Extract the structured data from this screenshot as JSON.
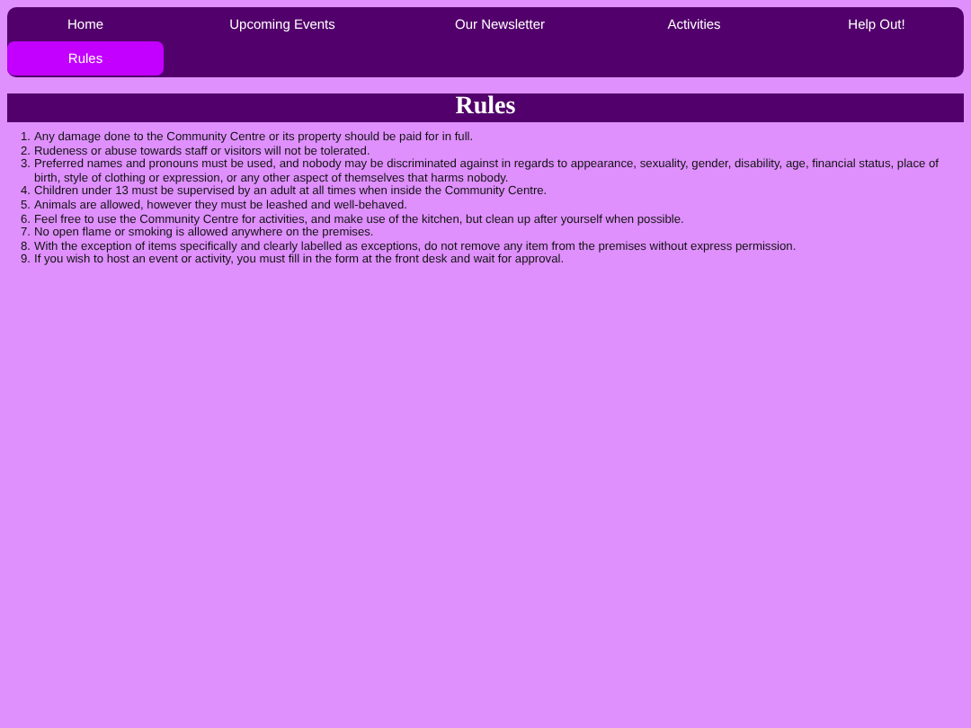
{
  "nav": [
    {
      "label": "Home",
      "selected": false
    },
    {
      "label": "Upcoming Events",
      "selected": false
    },
    {
      "label": "Our Newsletter",
      "selected": false
    },
    {
      "label": "Activities",
      "selected": false
    },
    {
      "label": "Help Out!",
      "selected": false
    },
    {
      "label": "Rules",
      "selected": true
    }
  ],
  "heading": "Rules",
  "rules": [
    {
      "marker": "1.",
      "text": "Any damage done to the Community Centre or its property should be paid for in full."
    },
    {
      "marker": "2.",
      "text": "Rudeness or abuse towards staff or visitors will not be tolerated."
    },
    {
      "marker": "3.",
      "text": "Preferred names and pronouns must be used, and nobody may be discriminated against in regards to appearance, sexuality, gender, disability, age, financial status, place of birth, style of clothing or expression, or any other aspect of themselves that harms nobody."
    },
    {
      "marker": "4.",
      "text": "Children under 13 must be supervised by an adult at all times when inside the Community Centre."
    },
    {
      "marker": "5.",
      "text": "Animals are allowed, however they must be leashed and well-behaved."
    },
    {
      "marker": "6.",
      "text": "Feel free to use the Community Centre for activities, and make use of the kitchen, but clean up after yourself when possible."
    },
    {
      "marker": "7.",
      "text": "No open flame or smoking is allowed anywhere on the premises."
    },
    {
      "marker": "8.",
      "text": "With the exception of items specifically and clearly labelled as exceptions, do not remove any item from the premises without express permission."
    },
    {
      "marker": "9.",
      "text": "If you wish to host an event or activity, you must fill in the form at the front desk and wait for approval."
    }
  ]
}
